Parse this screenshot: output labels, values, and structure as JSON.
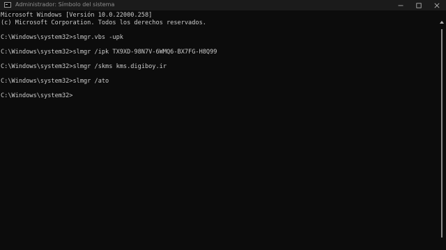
{
  "window": {
    "title": "Administrador: Símbolo del sistema"
  },
  "icons": {
    "app": "console-icon",
    "minimize": "minimize-icon",
    "maximize": "maximize-icon",
    "close": "close-icon"
  },
  "console": {
    "lines": [
      "Microsoft Windows [Versión 10.0.22000.258]",
      "(c) Microsoft Corporation. Todos los derechos reservados.",
      "",
      "C:\\Windows\\system32>slmgr.vbs -upk",
      "",
      "C:\\Windows\\system32>slmgr /ipk TX9XD-98N7V-6WMQ6-BX7FG-H8Q99",
      "",
      "C:\\Windows\\system32>slmgr /skms kms.digiboy.ir",
      "",
      "C:\\Windows\\system32>slmgr /ato",
      "",
      "C:\\Windows\\system32>"
    ]
  },
  "colors": {
    "background": "#0c0c0c",
    "text": "#cccccc",
    "titlebar": "#1b1b1b",
    "title_text": "#8e8e8e"
  }
}
